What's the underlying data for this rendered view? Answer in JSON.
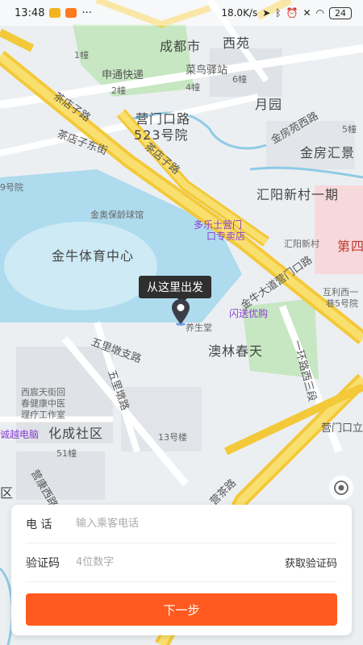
{
  "status_bar": {
    "time": "13:48",
    "dots": "···",
    "net_speed": "18.0K/s",
    "battery": "24"
  },
  "map": {
    "labels": {
      "chengdu": "成都市",
      "xiyuan": "西苑",
      "cainiao": "菜鸟驿站",
      "shentong": "申通快递",
      "b1": "1幢",
      "b2": "2幢",
      "b4": "4幢",
      "b6": "6幢",
      "b5": "5幢",
      "b13": "13号楼",
      "b51": "51幢",
      "yingmenkou": "营门口路",
      "yingmenkou523": "523号院",
      "yueyuan": "月园",
      "jinfang_road": "金房苑西路",
      "jinfang": "金房汇景",
      "chadianzi": "茶店子路",
      "chadianzi_east": "茶店子东街",
      "chadianzi2": "茶店子路",
      "huiyang": "汇阳新村一期",
      "huiyang2": "汇阳新村",
      "jinao": "金奥保龄球馆",
      "duole": "多乐士营门",
      "duole2": "口专卖店",
      "jinniu": "金牛体育中心",
      "jinniu_road": "金牛大道营门口路",
      "wulidun": "五里墩支路",
      "wulidun2": "五里墩路",
      "shanyao": "闪送优购",
      "aolin": "澳林春天",
      "yangsheng": "养生堂",
      "xichen": "西宸天街回",
      "xichen2": "春健康中医",
      "xichen3": "理疗工作室",
      "chengyue": "诚越电脑",
      "huacheng": "化成社区",
      "yingkang": "营康西路",
      "yingmen_li": "营门口立",
      "yingjiu": "营茶路",
      "huli": "互利西一",
      "huli2": "巷5号院",
      "no9": "9号院",
      "yiHuan": "一环路西三段",
      "di4": "第四",
      "qu": "区"
    }
  },
  "pin": {
    "tooltip": "从这里出发"
  },
  "form": {
    "phone_label": "电 话",
    "phone_placeholder": "输入乘客电话",
    "code_label": "验证码",
    "code_placeholder": "4位数字",
    "get_code": "获取验证码",
    "next": "下一步"
  },
  "colors": {
    "accent": "#ff5a1f",
    "water": "#a9d8ec",
    "green": "#b8e0b5",
    "road": "#f7d64a"
  }
}
